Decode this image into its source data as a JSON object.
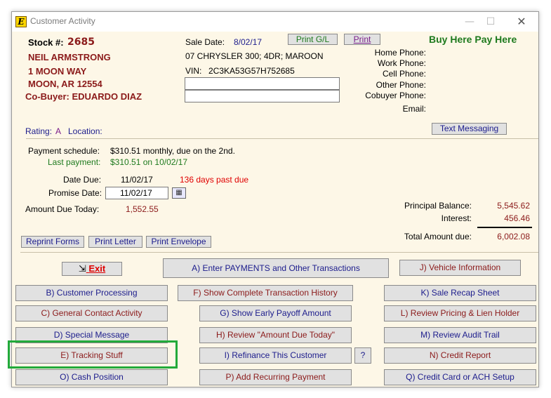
{
  "window": {
    "title": "Customer Activity",
    "app_icon_glyph": "E",
    "min_glyph": "—",
    "max_glyph": "☐",
    "close_glyph": "✕"
  },
  "customer": {
    "stock_label": "Stock #:",
    "stock_number": "2685",
    "name": "NEIL ARMSTRONG",
    "address1": "1 MOON WAY",
    "address2": "MOON, AR 12554",
    "cobuyer": "Co-Buyer: EDUARDO DIAZ"
  },
  "sale": {
    "date_label": "Sale Date:",
    "date": "8/02/17",
    "vehicle": "07 CHRYSLER 300; 4DR; MAROON",
    "vin_label": "VIN:",
    "vin": "2C3KA53G57H752685",
    "field1": "",
    "field2": ""
  },
  "header_buttons": {
    "print_gl": "Print G/L",
    "print": "Print"
  },
  "brand": "Buy Here Pay Here",
  "phones": {
    "home": "Home Phone:",
    "work": "Work Phone:",
    "cell": "Cell Phone:",
    "other": "Other Phone:",
    "cobuyer": "Cobuyer Phone:",
    "email": "Email:"
  },
  "rating": {
    "label": "Rating:",
    "value": "A",
    "location_label": "Location:"
  },
  "text_messaging": "Text Messaging",
  "payment": {
    "schedule_label": "Payment schedule:",
    "schedule_value": "$310.51 monthly, due on the 2nd.",
    "last_label": "Last payment:",
    "last_value": "$310.51 on 10/02/17",
    "date_due_label": "Date Due:",
    "date_due": "11/02/17",
    "past_due": "136 days past due",
    "promise_label": "Promise Date:",
    "promise_date": "11/02/17",
    "amount_due_label": "Amount Due Today:",
    "amount_due": "1,552.55"
  },
  "balance": {
    "principal_label": "Principal Balance:",
    "principal": "5,545.62",
    "interest_label": "Interest:",
    "interest": "456.46",
    "total_label": "Total Amount due:",
    "total": "6,002.08"
  },
  "small_buttons": {
    "reprint": "Reprint Forms",
    "letter": "Print Letter",
    "envelope": "Print Envelope"
  },
  "actions": {
    "exit": "Exit",
    "enter_payments": "A) Enter PAYMENTS and Other Transactions",
    "vehicle_info": "J) Vehicle Information",
    "customer_processing": "B) Customer Processing",
    "transaction_history": "F) Show Complete Transaction History",
    "sale_recap": "K) Sale Recap Sheet",
    "contact_activity": "C) General Contact Activity",
    "early_payoff": "G) Show Early Payoff Amount",
    "review_pricing": "L) Review Pricing & Lien Holder",
    "special_message": "D) Special Message",
    "review_amount_due": "H) Review \"Amount Due Today\"",
    "audit_trail": "M) Review Audit Trail",
    "tracking_stuff": "E) Tracking Stuff",
    "refinance": "I) Refinance This Customer",
    "help": "?",
    "credit_report": "N) Credit Report",
    "cash_position": "O) Cash Position",
    "recurring_payment": "P) Add Recurring Payment",
    "credit_card": "Q) Credit Card or ACH Setup"
  }
}
